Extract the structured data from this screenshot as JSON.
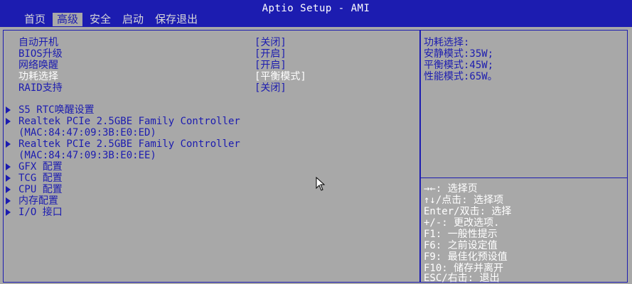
{
  "header": {
    "title": "Aptio Setup - AMI",
    "tabs": [
      {
        "label": "首页"
      },
      {
        "label": "高级"
      },
      {
        "label": "安全"
      },
      {
        "label": "启动"
      },
      {
        "label": "保存退出"
      }
    ],
    "active_tab": "高级"
  },
  "settings": [
    {
      "label": "自动开机",
      "value": "[关闭]"
    },
    {
      "label": "BIOS升级",
      "value": "[开启]"
    },
    {
      "label": "网络唤醒",
      "value": "[开启]"
    },
    {
      "label": "功耗选择",
      "value": "[平衡模式]",
      "selected": true
    },
    {
      "label": "RAID支持",
      "value": "[关闭]"
    }
  ],
  "submenus": [
    {
      "label": "S5 RTC唤醒设置"
    },
    {
      "label": "Realtek PCIe 2.5GBE Family Controller",
      "sub": "(MAC:84:47:09:3B:E0:ED)"
    },
    {
      "label": "Realtek PCIe 2.5GBE Family Controller",
      "sub": "(MAC:84:47:09:3B:E0:EE)"
    },
    {
      "label": "GFX 配置"
    },
    {
      "label": "TCG 配置"
    },
    {
      "label": "CPU 配置"
    },
    {
      "label": "内存配置"
    },
    {
      "label": "I/O 接口"
    }
  ],
  "help": {
    "lines": [
      "功耗选择:",
      "安静模式:35W;",
      "平衡模式:45W;",
      "性能模式:65W。"
    ]
  },
  "keys": {
    "lines": [
      "→←: 选择页",
      "↑↓/点击: 选择项",
      "Enter/双击: 选择",
      "+/-: 更改选项.",
      "F1: 一般性提示",
      "F6: 之前设定值",
      "F9: 最佳化预设值",
      "F10: 储存并离开",
      "ESC/右击: 退出"
    ]
  },
  "colors": {
    "accent": "#1c1cb0",
    "background": "#a8a8a8",
    "highlight": "#ffffff"
  }
}
